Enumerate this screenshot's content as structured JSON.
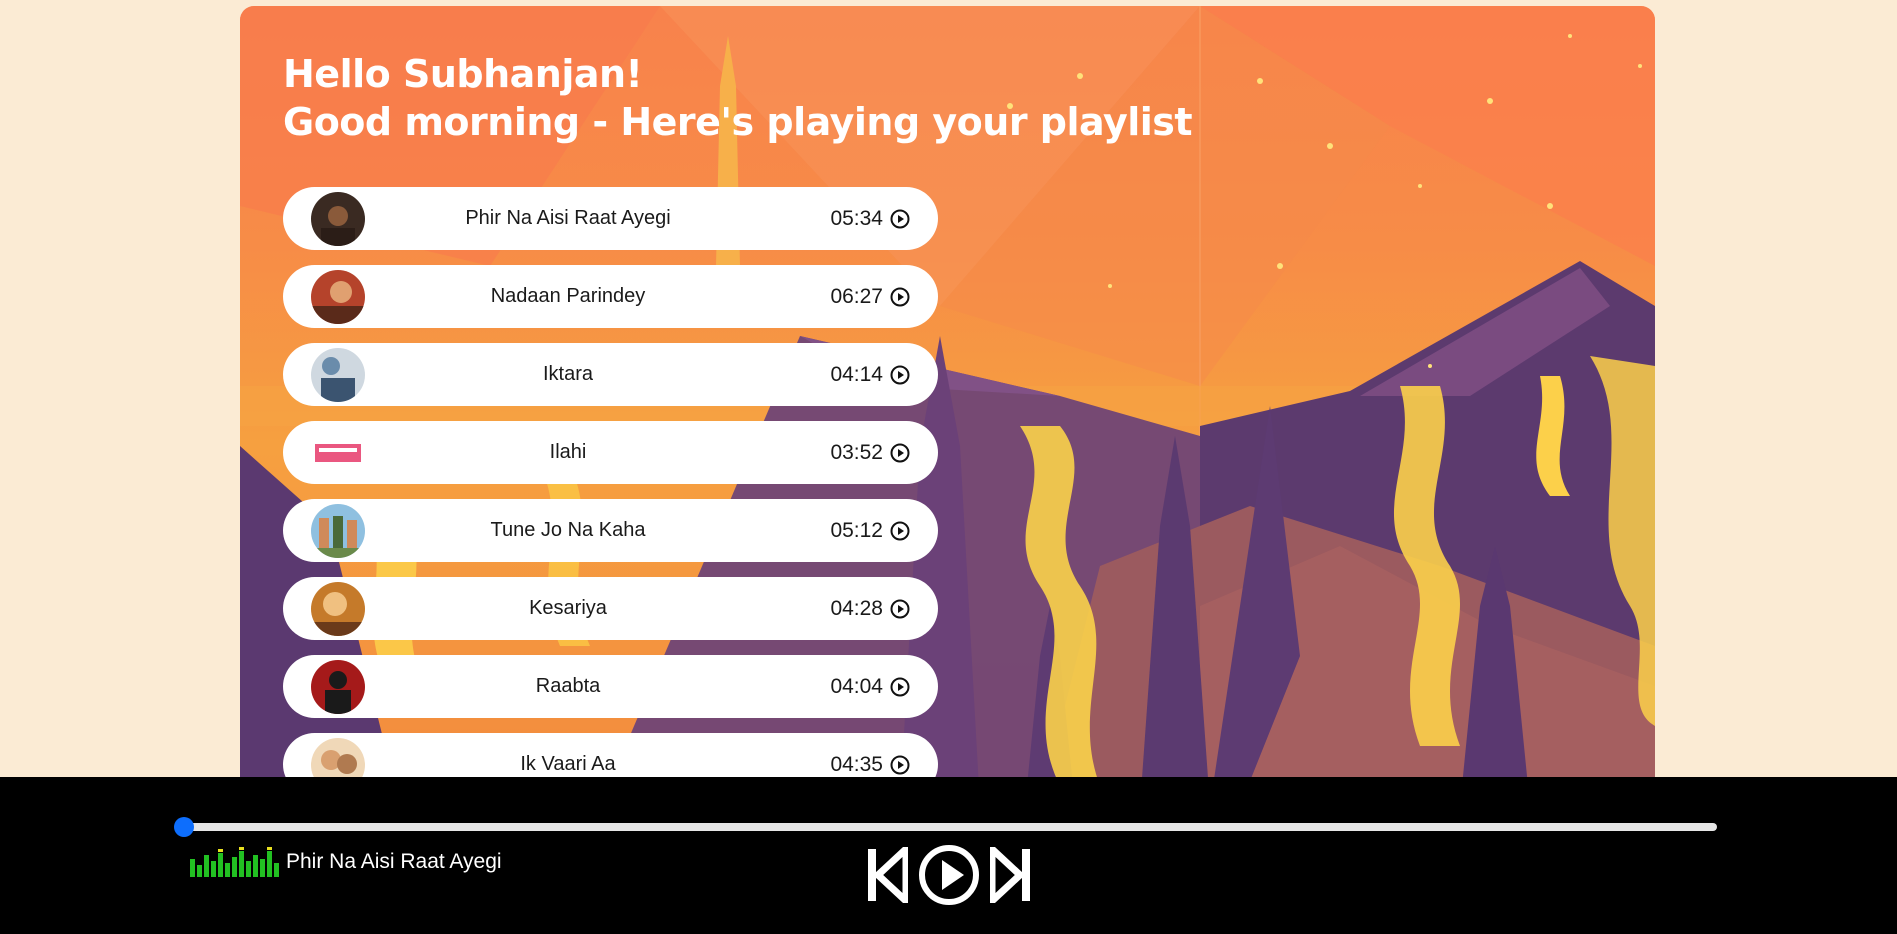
{
  "greeting": {
    "line1": "Hello Subhanjan!",
    "line2": "Good morning - Here's playing your playlist"
  },
  "songs": [
    {
      "name": "Phir Na Aisi Raat Ayegi",
      "duration": "05:34",
      "thumb_color": "#3a2a22"
    },
    {
      "name": "Nadaan Parindey",
      "duration": "06:27",
      "thumb_color": "#b5432b"
    },
    {
      "name": "Iktara",
      "duration": "04:14",
      "thumb_color": "#6a8cab"
    },
    {
      "name": "Ilahi",
      "duration": "03:52",
      "thumb_color": "#e63a6a"
    },
    {
      "name": "Tune Jo Na Kaha",
      "duration": "05:12",
      "thumb_color": "#6aa0c8"
    },
    {
      "name": "Kesariya",
      "duration": "04:28",
      "thumb_color": "#c57a2a"
    },
    {
      "name": "Raabta",
      "duration": "04:04",
      "thumb_color": "#a51a1a"
    },
    {
      "name": "Ik Vaari Aa",
      "duration": "04:35",
      "thumb_color": "#d9a070"
    }
  ],
  "player": {
    "now_playing": "Phir Na Aisi Raat Ayegi",
    "progress": 0.0,
    "accent": "#0d6efd",
    "equalizer_color": "#22c022"
  },
  "icons": {
    "song_play": "play-circle-icon",
    "prev": "skip-previous-icon",
    "play": "play-circle-icon",
    "next": "skip-next-icon",
    "equalizer": "equalizer-icon"
  }
}
